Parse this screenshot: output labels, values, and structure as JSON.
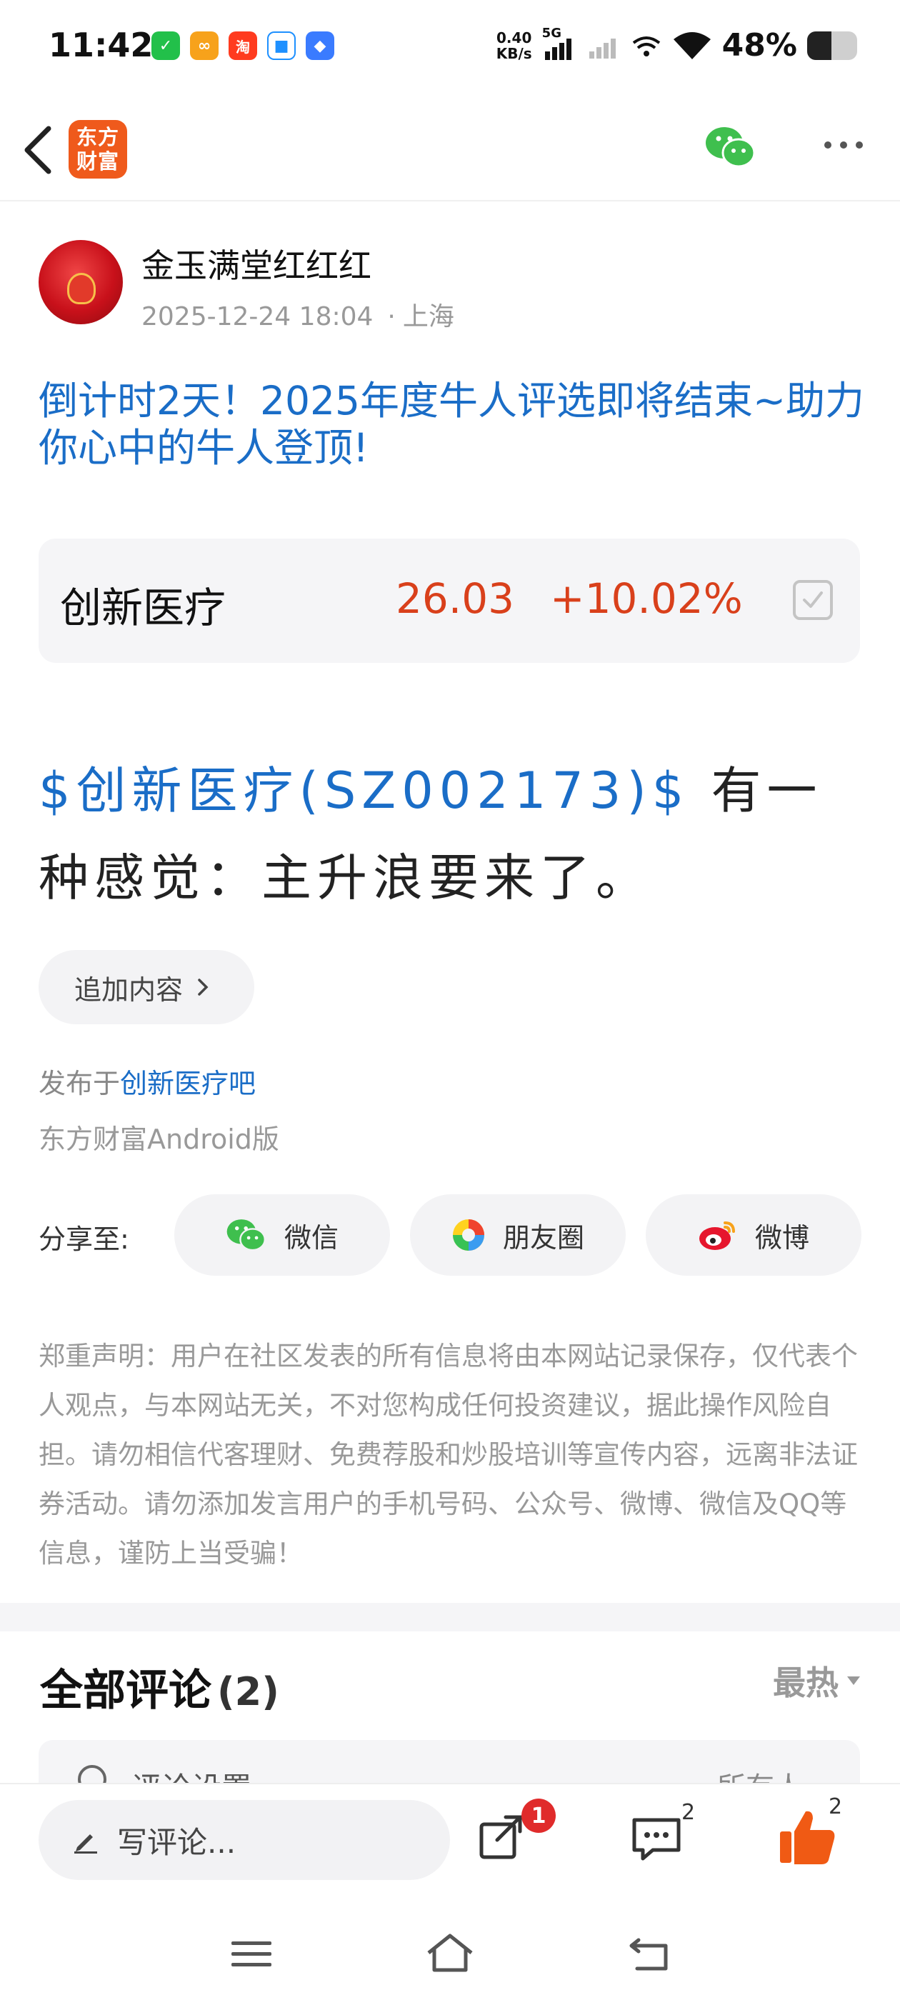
{
  "status_bar": {
    "time": "11:42",
    "net_speed_value": "0.40",
    "net_speed_unit": "KB/s",
    "network_type": "5G",
    "battery": "48%",
    "battery_level": 0.48,
    "apps": [
      {
        "icon": "v-app-icon",
        "color": "#22c04a",
        "glyph": "✓"
      },
      {
        "icon": "pinduo-icon",
        "color": "#f7a21b",
        "glyph": "∞"
      },
      {
        "icon": "taobao-icon",
        "color": "#ff3b1f",
        "glyph": "淘"
      },
      {
        "icon": "app-icon",
        "color": "#1e90ff",
        "glyph": "■"
      },
      {
        "icon": "link-icon",
        "color": "#3a7bff",
        "glyph": "◆"
      }
    ]
  },
  "nav": {
    "logo_line1": "东方",
    "logo_line2": "财富"
  },
  "author": {
    "name": "金玉满堂红红红",
    "time": "2025-12-24 18:04",
    "location": "上海"
  },
  "post": {
    "title": "倒计时2天！2025年度牛人评选即将结束~助力你心中的牛人登顶!",
    "stock_link": "$创新医疗(SZ002173)$",
    "body_text": " 有一种感觉：主升浪要来了。",
    "add_content_label": "追加内容",
    "published_prefix": "发布于",
    "published_bar": "创新医疗吧",
    "client": "东方财富Android版"
  },
  "stock": {
    "name": "创新医疗",
    "price": "26.03",
    "change": "+10.02%",
    "up_color": "#d9401b"
  },
  "share": {
    "label": "分享至:",
    "wechat": "微信",
    "moments": "朋友圈",
    "weibo": "微博"
  },
  "disclaimer": "郑重声明：用户在社区发表的所有信息将由本网站记录保存，仅代表个人观点，与本网站无关，不对您构成任何投资建议，据此操作风险自担。请勿相信代客理财、免费荐股和炒股培训等宣传内容，远离非法证券活动。请勿添加发言用户的手机号码、公众号、微博、微信及QQ等信息，谨防上当受骗！",
  "comments": {
    "title": "全部评论",
    "count": "(2)",
    "sort": "最热",
    "settings_label": "评论设置",
    "settings_value": "所有人"
  },
  "bottom_bar": {
    "write_placeholder": "写评论...",
    "share_badge": "1",
    "comment_count": "2",
    "like_count": "2"
  },
  "colors": {
    "link_blue": "#1a6dc7",
    "brand_orange": "#ef5a1c",
    "like_orange": "#f05a14"
  }
}
